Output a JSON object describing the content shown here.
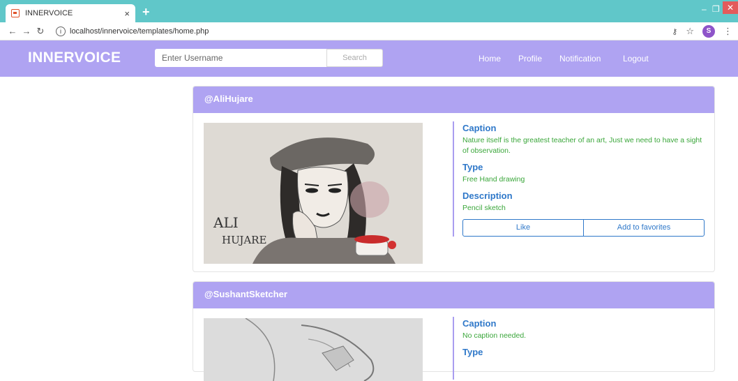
{
  "browser": {
    "tab_title": "INNERVOICE",
    "tab_close": "×",
    "new_tab": "+",
    "url": "localhost/innervoice/templates/home.php",
    "profile_initial": "S"
  },
  "navbar": {
    "brand": "INNERVOICE",
    "search_placeholder": "Enter Username",
    "search_button": "Search",
    "links": [
      "Home",
      "Profile",
      "Notification",
      "Logout"
    ]
  },
  "posts": [
    {
      "username": "@AliHujare",
      "artwork_signature": "ALI HUJARE",
      "caption_label": "Caption",
      "caption": "Nature itself is the greatest teacher of an art, Just we need to have a sight of observation.",
      "type_label": "Type",
      "type": "Free Hand drawing",
      "description_label": "Description",
      "description": "Pencil sketch",
      "like_label": "Like",
      "favorite_label": "Add to favorites"
    },
    {
      "username": "@SushantSketcher",
      "caption_label": "Caption",
      "caption": "No caption needed.",
      "type_label": "Type"
    }
  ],
  "colors": {
    "accent": "#afa3f2",
    "browser_bar": "#60c7c9",
    "label_blue": "#2f78c9",
    "value_green": "#3aa63a"
  }
}
